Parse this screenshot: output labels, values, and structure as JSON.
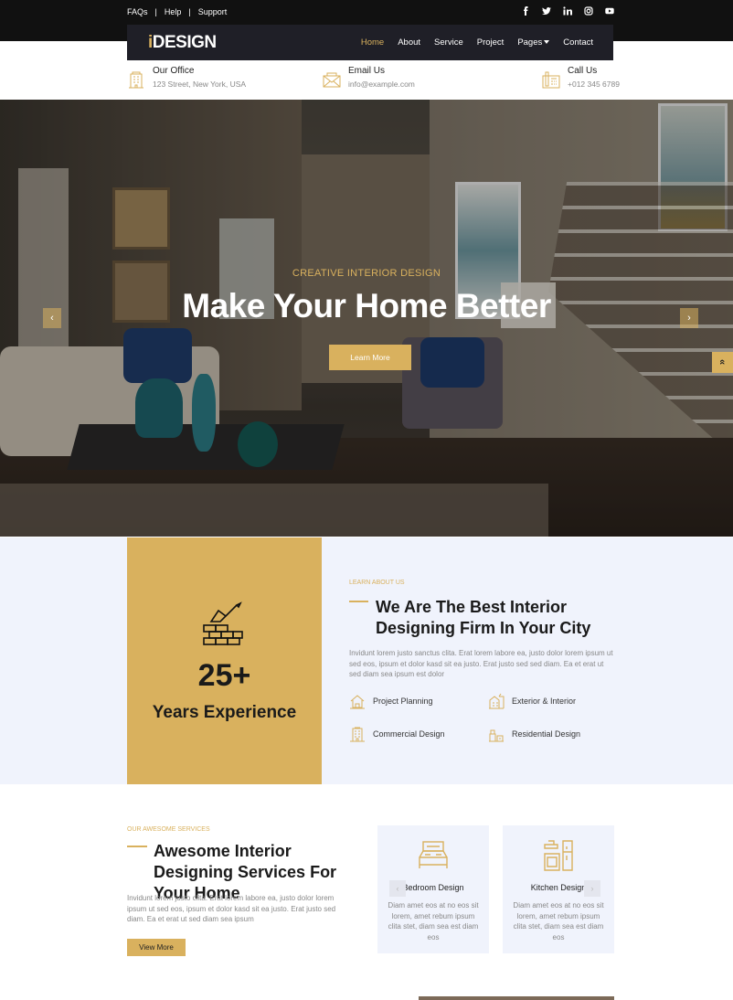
{
  "topbar": {
    "links": [
      "FAQs",
      "Help",
      "Support"
    ],
    "socials": [
      "facebook-icon",
      "twitter-icon",
      "linkedin-icon",
      "instagram-icon",
      "youtube-icon"
    ]
  },
  "nav": {
    "logo_i": "i",
    "logo_rest": "DESIGN",
    "items": [
      "Home",
      "About",
      "Service",
      "Project",
      "Pages",
      "Contact"
    ],
    "active": "Home"
  },
  "info": [
    {
      "title": "Our Office",
      "value": "123 Street, New York, USA",
      "icon": "building-icon"
    },
    {
      "title": "Email Us",
      "value": "info@example.com",
      "icon": "envelope-icon"
    },
    {
      "title": "Call Us",
      "value": "+012 345 6789",
      "icon": "phone-icon"
    }
  ],
  "hero": {
    "kicker": "CREATIVE INTERIOR DESIGN",
    "title": "Make Your Home Better",
    "button": "Learn More",
    "prev": "‹",
    "next": "›"
  },
  "totop": "«",
  "about": {
    "exp_number": "25+",
    "exp_label": "Years Experience",
    "kicker": "LEARN ABOUT US",
    "title": "We Are The Best Interior Designing Firm In Your City",
    "text": "Invidunt lorem justo sanctus clita. Erat lorem labore ea, justo dolor lorem ipsum ut sed eos, ipsum et dolor kasd sit ea justo. Erat justo sed sed diam. Ea et erat ut sed diam sea ipsum est dolor",
    "features": [
      {
        "label": "Project Planning",
        "icon": "house-plan-icon"
      },
      {
        "label": "Exterior & Interior",
        "icon": "building-crane-icon"
      },
      {
        "label": "Commercial Design",
        "icon": "office-building-icon"
      },
      {
        "label": "Residential Design",
        "icon": "residential-house-icon"
      }
    ]
  },
  "services": {
    "kicker": "OUR AWESOME SERVICES",
    "title": "Awesome Interior Designing Services For Your Home",
    "text": "Invidunt lorem justo clita. Erat lorem labore ea, justo dolor lorem ipsum ut sed eos, ipsum et dolor kasd sit ea justo. Erat justo sed diam. Ea et erat ut sed diam sea ipsum",
    "button": "View More",
    "cards": [
      {
        "title": "Bedroom Design",
        "text": "Diam amet eos at no eos sit lorem, amet rebum ipsum clita stet, diam sea est diam eos",
        "icon": "bed-icon"
      },
      {
        "title": "Kitchen Design",
        "text": "Diam amet eos at no eos sit lorem, amet rebum ipsum clita stet, diam sea est diam eos",
        "icon": "kitchen-icon"
      }
    ],
    "prev": "‹",
    "next": "›"
  },
  "colors": {
    "accent": "#d9b15e",
    "dark": "#1f1f27",
    "light_bg": "#f0f3fc"
  }
}
